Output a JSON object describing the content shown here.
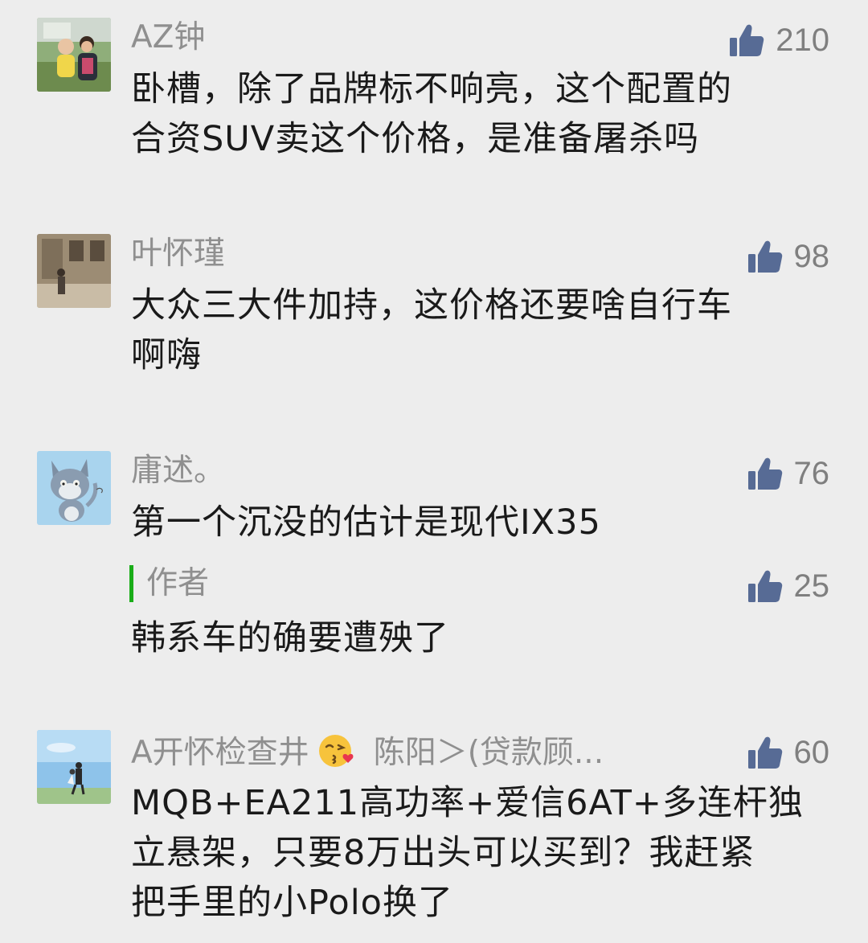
{
  "comments": [
    {
      "name": "AZ钟",
      "likes": "210",
      "text_lines": [
        "卧槽，除了品牌标不响亮，这个配置的",
        "合资SUV卖这个价格，是准备屠杀吗"
      ]
    },
    {
      "name": "叶怀瑾",
      "likes": "98",
      "text_lines": [
        "大众三大件加持，这价格还要啥自行车",
        "啊嗨"
      ]
    },
    {
      "name": "庸述。",
      "likes": "76",
      "text_lines": [
        "第一个沉没的估计是现代IX35"
      ],
      "reply": {
        "label": "作者",
        "likes": "25",
        "text": "韩系车的确要遭殃了"
      }
    },
    {
      "name": "A开怀检查井",
      "name_emoji": "kissing-face-emoji",
      "name_extra": "陈阳＞(贷款顾...",
      "likes": "60",
      "text_lines": [
        "MQB+EA211高功率+爱信6AT+多连杆独",
        "立悬架，只要8万出头可以买到？我赶紧",
        "把手里的小Polo换了"
      ]
    }
  ],
  "icons": {
    "like": "thumbs-up-icon"
  },
  "colors": {
    "background": "#ededed",
    "text": "#1a1a1a",
    "secondary": "#8f8f8f",
    "like_icon": "#576b95",
    "author_bar": "#1aad19"
  }
}
